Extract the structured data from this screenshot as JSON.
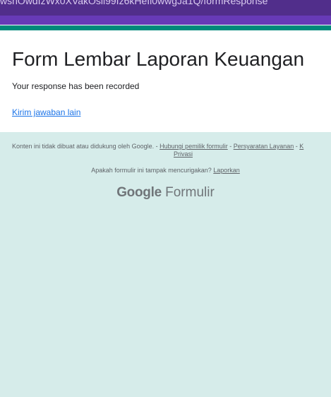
{
  "browser": {
    "url_fragment": "wshOwdIzWx0XVakOsil99Iz6kHeIl0wwgJa1Q/formResponse"
  },
  "form": {
    "title": "Form Lembar Laporan Keuangan",
    "confirmation": "Your response has been recorded",
    "submit_another_link": "Kirim jawaban lain"
  },
  "footer": {
    "disclaimer": "Konten ini tidak dibuat atau didukung oleh Google.",
    "sep1": " - ",
    "contact_owner_link": "Hubungi pemilik formulir",
    "sep2": " - ",
    "terms_link": "Persyaratan Layanan",
    "sep3": " - ",
    "privacy_link_start": "K",
    "privacy_link_end": "Privasi",
    "suspicious_text": "Apakah formulir ini tampak mencurigakan? ",
    "report_link": "Laporkan"
  },
  "brand": {
    "google": "Google",
    "product": "Formulir"
  },
  "colors": {
    "header_purple": "#673ab7",
    "accent_teal": "#00897b",
    "background": "#d6ecea",
    "link_blue": "#1a73e8"
  }
}
